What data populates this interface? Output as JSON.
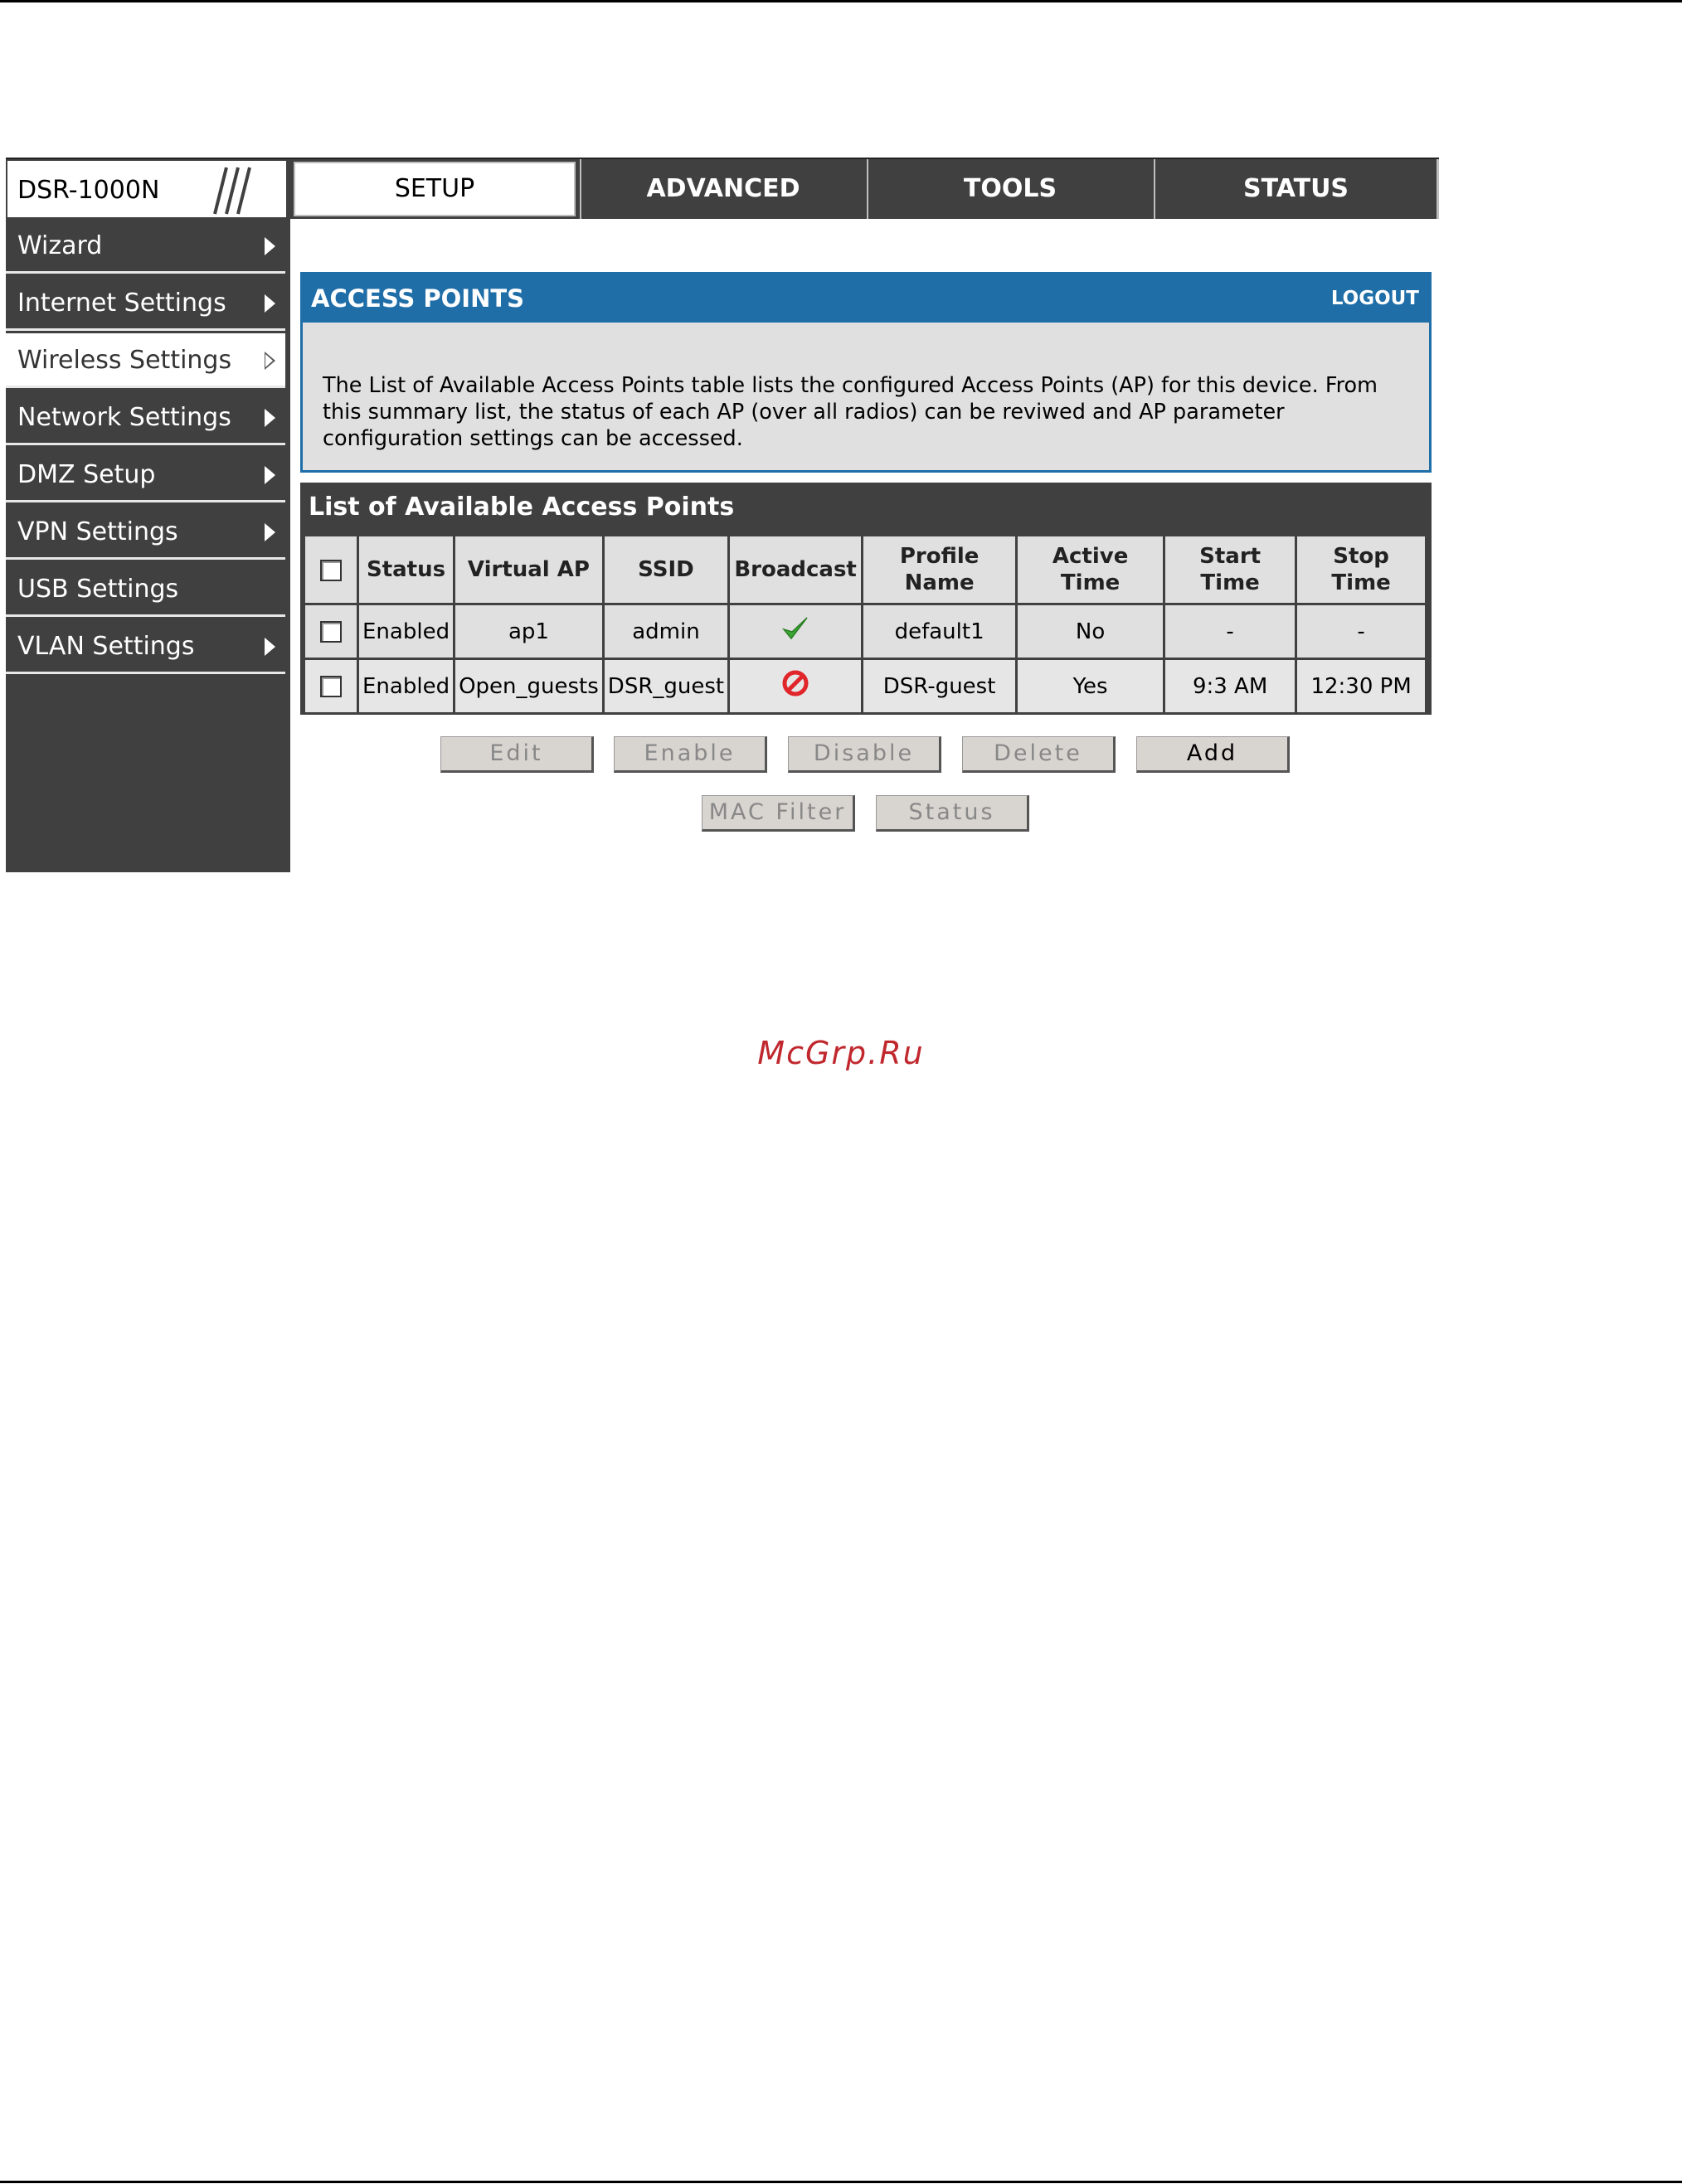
{
  "header": {
    "model": "DSR-1000N",
    "tabs": [
      {
        "label": "SETUP",
        "active": true
      },
      {
        "label": "ADVANCED",
        "active": false
      },
      {
        "label": "TOOLS",
        "active": false
      },
      {
        "label": "STATUS",
        "active": false
      }
    ]
  },
  "sidebar": {
    "items": [
      {
        "label": "Wizard",
        "has_arrow": true
      },
      {
        "label": "Internet Settings",
        "has_arrow": true
      },
      {
        "label": "Wireless Settings",
        "has_arrow": true,
        "active": true
      },
      {
        "label": "Network Settings",
        "has_arrow": true
      },
      {
        "label": "DMZ Setup",
        "has_arrow": true
      },
      {
        "label": "VPN Settings",
        "has_arrow": true
      },
      {
        "label": "USB Settings",
        "has_arrow": false
      },
      {
        "label": "VLAN Settings",
        "has_arrow": true
      }
    ]
  },
  "panel": {
    "title": "ACCESS POINTS",
    "logout": "LOGOUT",
    "description": "The List of Available Access Points table lists the configured Access Points (AP) for this device. From this summary list, the status of each AP (over all radios) can be reviwed and AP parameter configuration settings can be accessed."
  },
  "list": {
    "title": "List of Available Access Points",
    "columns": {
      "status": "Status",
      "virtual_ap": "Virtual AP",
      "ssid": "SSID",
      "broadcast": "Broadcast",
      "profile_name": "Profile Name",
      "active_time": "Active Time",
      "start_time": "Start Time",
      "stop_time": "Stop Time"
    },
    "rows": [
      {
        "status": "Enabled",
        "virtual_ap": "ap1",
        "ssid": "admin",
        "broadcast": "check-icon",
        "profile_name": "default1",
        "active_time": "No",
        "start_time": "-",
        "stop_time": "-"
      },
      {
        "status": "Enabled",
        "virtual_ap": "Open_guests",
        "ssid": "DSR_guest",
        "broadcast": "prohibited-icon",
        "profile_name": "DSR-guest",
        "active_time": "Yes",
        "start_time": "9:3 AM",
        "stop_time": "12:30 PM"
      }
    ]
  },
  "buttons": {
    "edit": "Edit",
    "enable": "Enable",
    "disable": "Disable",
    "delete": "Delete",
    "add": "Add",
    "mac_filter": "MAC Filter",
    "status": "Status"
  },
  "colors": {
    "panel_header": "#1f6ea8",
    "dark_bar": "#404040",
    "check": "#3aa832",
    "prohibited": "#e0262a",
    "watermark": "#c0282e"
  },
  "watermark": "McGrp.Ru"
}
